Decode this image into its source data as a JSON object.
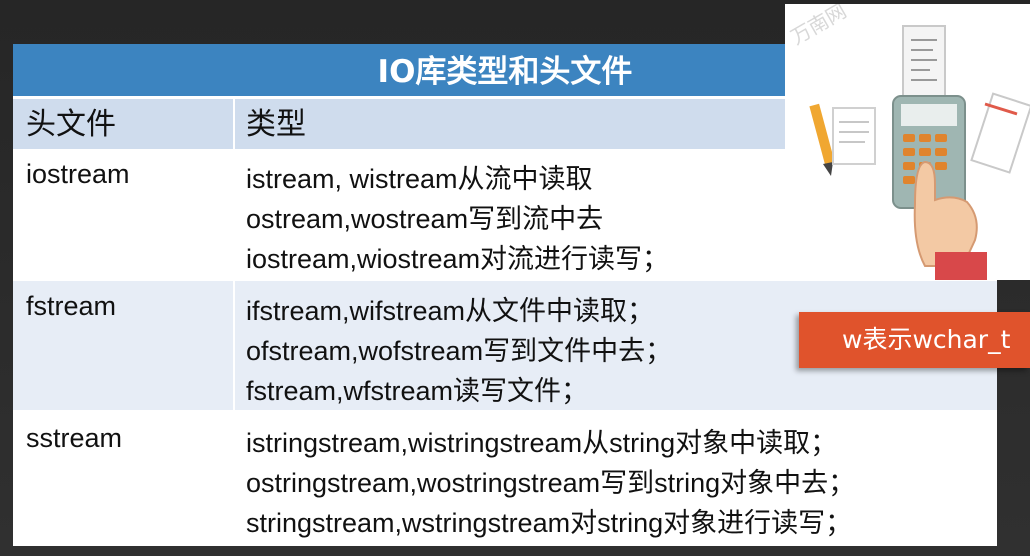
{
  "table": {
    "title": "IO库类型和头文件",
    "headers": [
      "头文件",
      "类型"
    ],
    "rows": [
      {
        "header": "iostream",
        "types": [
          "istream, wistream从流中读取",
          "ostream,wostream写到流中去",
          "iostream,wiostream对流进行读写；"
        ]
      },
      {
        "header": "fstream",
        "types": [
          "ifstream,wifstream从文件中读取；",
          "ofstream,wofstream写到文件中去；",
          "fstream,wfstream读写文件；"
        ]
      },
      {
        "header": "sstream",
        "types": [
          "istringstream,wistringstream从string对象中读取；",
          "ostringstream,wostringstream写到string对象中去；",
          "stringstream,wstringstream对string对象进行读写；"
        ]
      }
    ]
  },
  "badge": {
    "text": "w表示wchar_t"
  },
  "illustration": {
    "icon": "calculator-hand-icon",
    "watermark": "万南网"
  },
  "colors": {
    "title_bg": "#3c84c0",
    "header_bg": "#cfdced",
    "row_alt": "#e7edf6",
    "badge_bg": "#e0532c",
    "bg": "#2b2b2b"
  }
}
